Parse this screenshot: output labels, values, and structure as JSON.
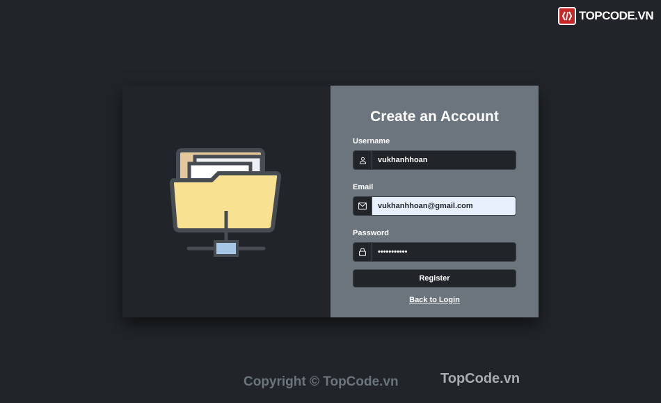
{
  "brand": {
    "logo_text": "TOPCODE.VN",
    "watermark": "TopCode.vn",
    "logo_color": "#c62828"
  },
  "form": {
    "title": "Create an Account",
    "username": {
      "label": "Username",
      "value": "vukhanhhoan",
      "icon": "user-icon"
    },
    "email": {
      "label": "Email",
      "value": "vukhanhhoan@gmail.com",
      "icon": "envelope-icon"
    },
    "password": {
      "label": "Password",
      "value": "•••••••••••",
      "icon": "lock-icon"
    },
    "register_label": "Register",
    "back_label": "Back to Login"
  },
  "illustration": {
    "icon": "shared-folder-icon"
  },
  "footer": {
    "copyright": "Copyright © TopCode.vn"
  },
  "colors": {
    "background": "#212529",
    "panel": "#6c757d",
    "input": "#212529",
    "autofill": "#e8f0fe"
  }
}
